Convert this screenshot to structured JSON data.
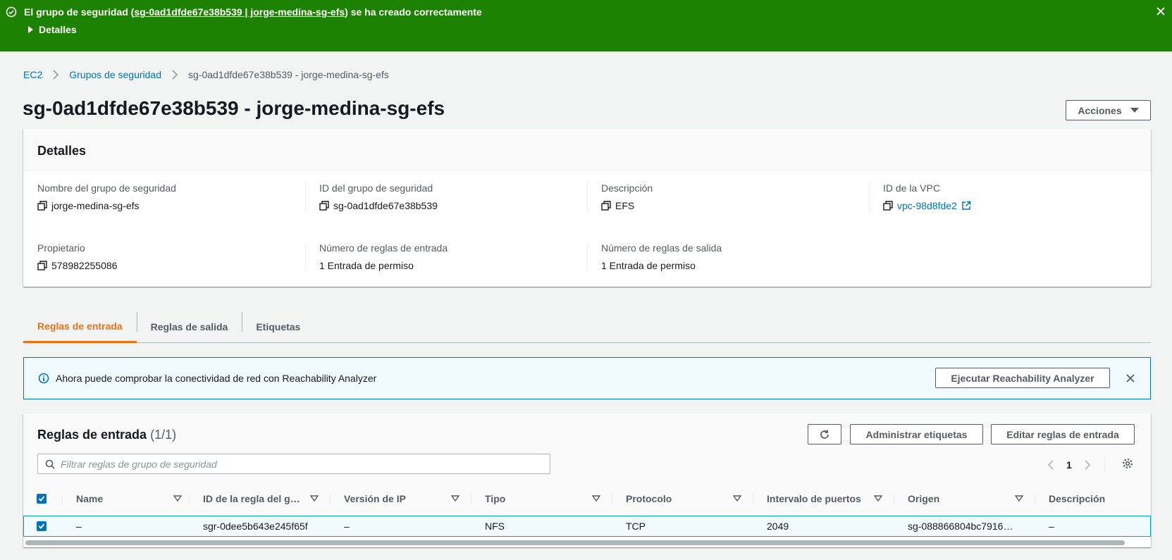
{
  "flash": {
    "prefix": "El grupo de seguridad (",
    "link": "sg-0ad1dfde67e38b539 | jorge-medina-sg-efs",
    "suffix": ") se ha creado correctamente",
    "details_label": "Detalles"
  },
  "breadcrumb": {
    "items": [
      "EC2",
      "Grupos de seguridad"
    ],
    "current": "sg-0ad1dfde67e38b539 - jorge-medina-sg-efs"
  },
  "page": {
    "title": "sg-0ad1dfde67e38b539 - jorge-medina-sg-efs",
    "actions_label": "Acciones"
  },
  "details": {
    "header": "Detalles",
    "fields": [
      {
        "label": "Nombre del grupo de seguridad",
        "value": "jorge-medina-sg-efs",
        "copy": true
      },
      {
        "label": "ID del grupo de seguridad",
        "value": "sg-0ad1dfde67e38b539",
        "copy": true
      },
      {
        "label": "Descripción",
        "value": "EFS",
        "copy": true
      },
      {
        "label": "ID de la VPC",
        "value": "vpc-98d8fde2",
        "copy": true,
        "link": true
      },
      {
        "label": "Propietario",
        "value": "578982255086",
        "copy": true
      },
      {
        "label": "Número de reglas de entrada",
        "value": "1 Entrada de permiso",
        "copy": false
      },
      {
        "label": "Número de reglas de salida",
        "value": "1 Entrada de permiso",
        "copy": false
      }
    ]
  },
  "tabs": [
    {
      "label": "Reglas de entrada",
      "active": true
    },
    {
      "label": "Reglas de salida",
      "active": false
    },
    {
      "label": "Etiquetas",
      "active": false
    }
  ],
  "alert": {
    "text": "Ahora puede comprobar la conectividad de red con Reachability Analyzer",
    "button": "Ejecutar Reachability Analyzer"
  },
  "rules": {
    "title": "Reglas de entrada",
    "count": "(1/1)",
    "manage_tags": "Administrar etiquetas",
    "edit_rules": "Editar reglas de entrada",
    "filter_placeholder": "Filtrar reglas de grupo de seguridad",
    "page": "1",
    "columns": [
      "Name",
      "ID de la regla del g…",
      "Versión de IP",
      "Tipo",
      "Protocolo",
      "Intervalo de puertos",
      "Origen",
      "Descripción"
    ],
    "rows": [
      [
        "–",
        "sgr-0dee5b643e245f65f",
        "–",
        "NFS",
        "TCP",
        "2049",
        "sg-088866804bc7916…",
        "–"
      ]
    ]
  },
  "colors": {
    "success": "#1d8102",
    "link": "#0073bb",
    "active_tab": "#ec7211",
    "info_bg": "#f1faff"
  }
}
